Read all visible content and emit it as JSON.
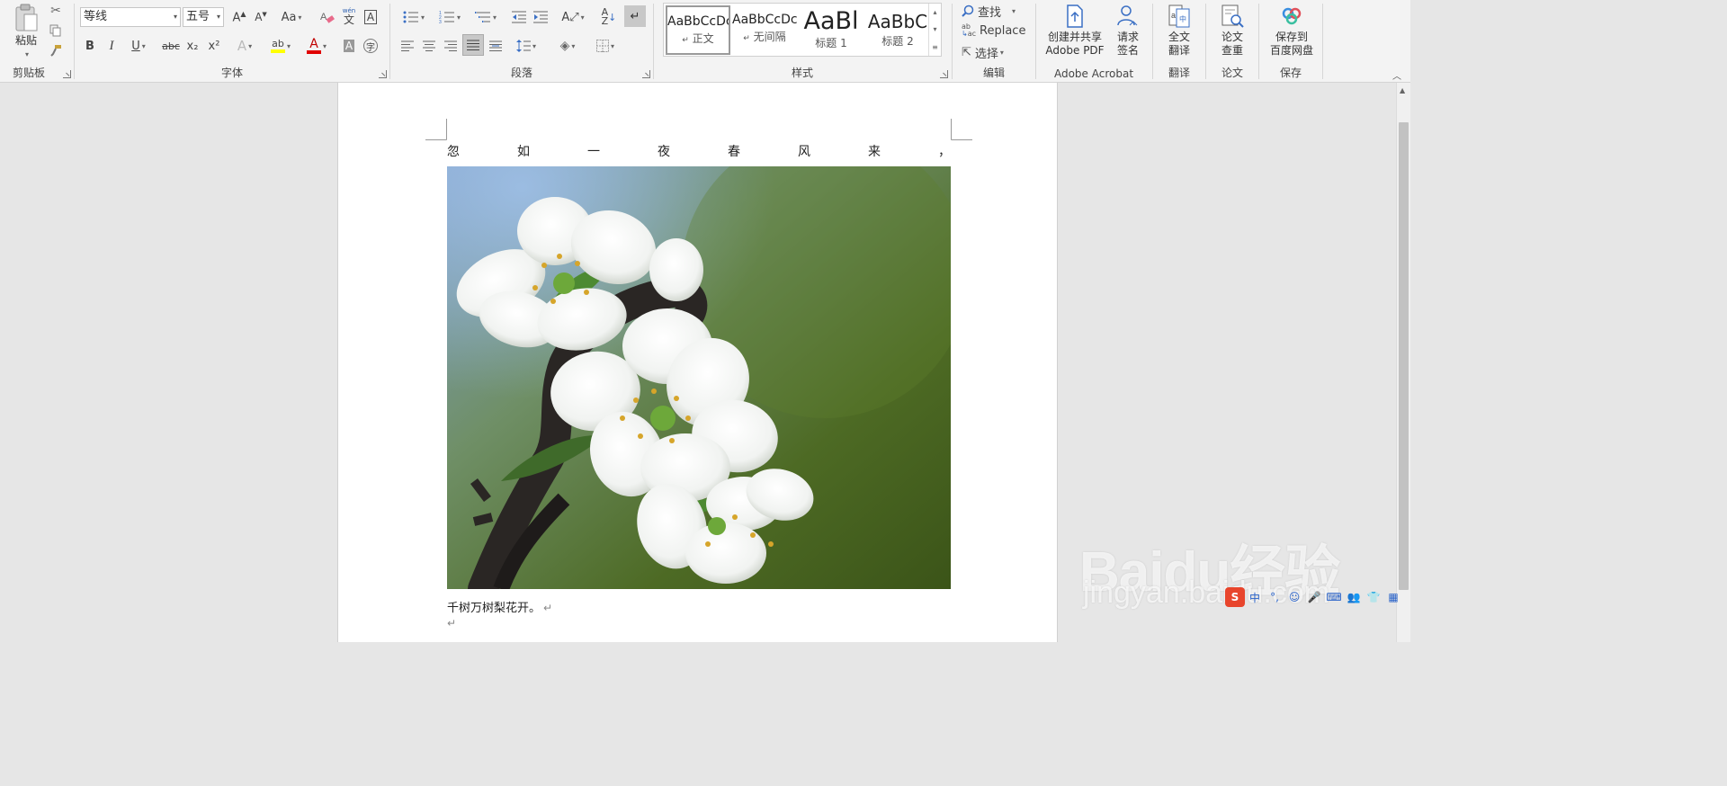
{
  "ribbon": {
    "clipboard": {
      "label": "剪贴板",
      "paste": "粘贴"
    },
    "font": {
      "label": "字体",
      "font_name": "等线",
      "font_size": "五号",
      "change_case": "Aa",
      "bold": "B",
      "italic": "I",
      "underline": "U",
      "strike": "abc",
      "subscript": "x₂",
      "superscript": "x²",
      "phonetic": "wén",
      "highlight_color": "#ffff00",
      "font_color": "#e00000"
    },
    "paragraph": {
      "label": "段落"
    },
    "styles": {
      "label": "样式",
      "items": [
        {
          "sample": "AaBbCcDc",
          "name": "正文"
        },
        {
          "sample": "AaBbCcDc",
          "name": "无间隔"
        },
        {
          "sample": "AaBl",
          "name": "标题 1"
        },
        {
          "sample": "AaBbC",
          "name": "标题 2"
        }
      ]
    },
    "editing": {
      "label": "编辑",
      "find": "查找",
      "replace": "Replace",
      "select": "选择"
    },
    "acrobat": {
      "label": "Adobe Acrobat",
      "create_pdf_1": "创建并共享",
      "create_pdf_2": "Adobe PDF",
      "sign_1": "请求",
      "sign_2": "签名"
    },
    "translate": {
      "label": "翻译",
      "full_1": "全文",
      "full_2": "翻译"
    },
    "paper": {
      "label": "论文",
      "check_1": "论文",
      "check_2": "查重"
    },
    "save": {
      "label": "保存",
      "cloud_1": "保存到",
      "cloud_2": "百度网盘"
    }
  },
  "document": {
    "line1_chars": [
      "忽",
      "如",
      "一",
      "夜",
      "春",
      "风",
      "来",
      "，"
    ],
    "caption": "千树万树梨花开。",
    "para_mark": "↵"
  },
  "watermark": {
    "brand": "Baidu经验",
    "url": "jingyan.baidu.com"
  }
}
